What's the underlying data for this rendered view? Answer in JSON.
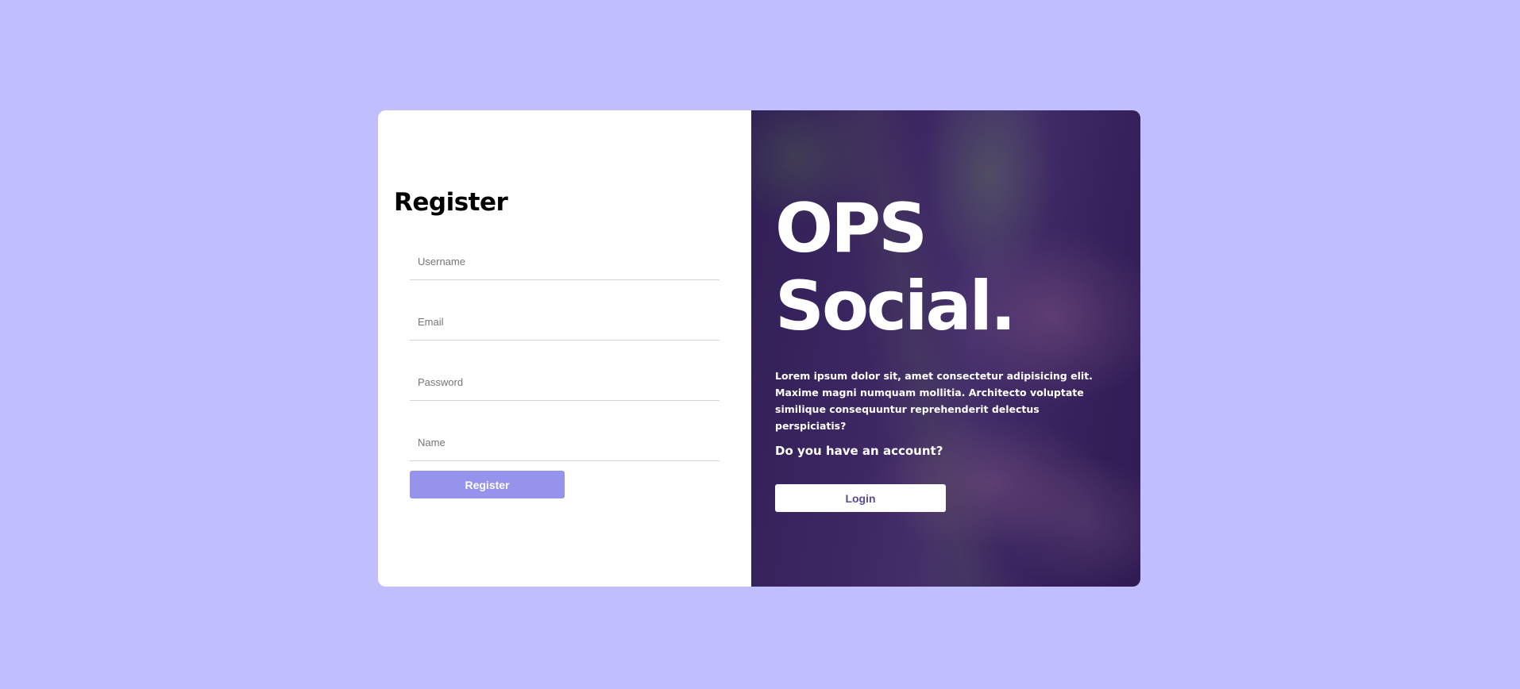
{
  "register": {
    "title": "Register",
    "fields": {
      "username_placeholder": "Username",
      "email_placeholder": "Email",
      "password_placeholder": "Password",
      "name_placeholder": "Name"
    },
    "submit_label": "Register"
  },
  "promo": {
    "brand_line1": "OPS",
    "brand_line2": "Social.",
    "description": "Lorem ipsum dolor sit, amet consectetur adipisicing elit. Maxime magni numquam mollitia. Architecto voluptate similique consequuntur reprehenderit delectus perspiciatis?",
    "question": "Do you have an account?",
    "login_label": "Login"
  },
  "colors": {
    "page_background": "#c1befe",
    "register_button": "#9593ec",
    "overlay": "#3a1c6e"
  }
}
